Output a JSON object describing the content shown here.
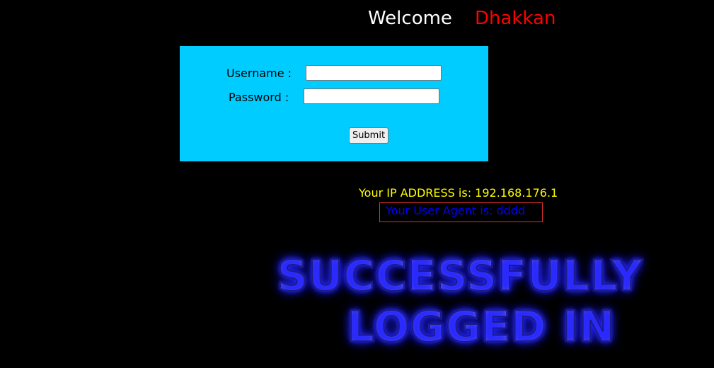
{
  "header": {
    "welcome": "Welcome",
    "name": "Dhakkan"
  },
  "form": {
    "username_label": "Username :",
    "password_label": "Password :",
    "username_value": "",
    "password_value": "",
    "submit_label": "Submit"
  },
  "info": {
    "ip_text": "Your IP ADDRESS is: 192.168.176.1",
    "user_agent_text": "Your User Agent is: dddd"
  },
  "banner": {
    "line1": "SUCCESSFULLY",
    "line2": "LOGGED IN"
  },
  "colors": {
    "background": "#000000",
    "panel": "#00ccff",
    "welcome": "#ffffff",
    "name": "#ff0000",
    "ip": "#ffff00",
    "user_agent": "#0000ff",
    "highlight_border": "#e03030"
  }
}
